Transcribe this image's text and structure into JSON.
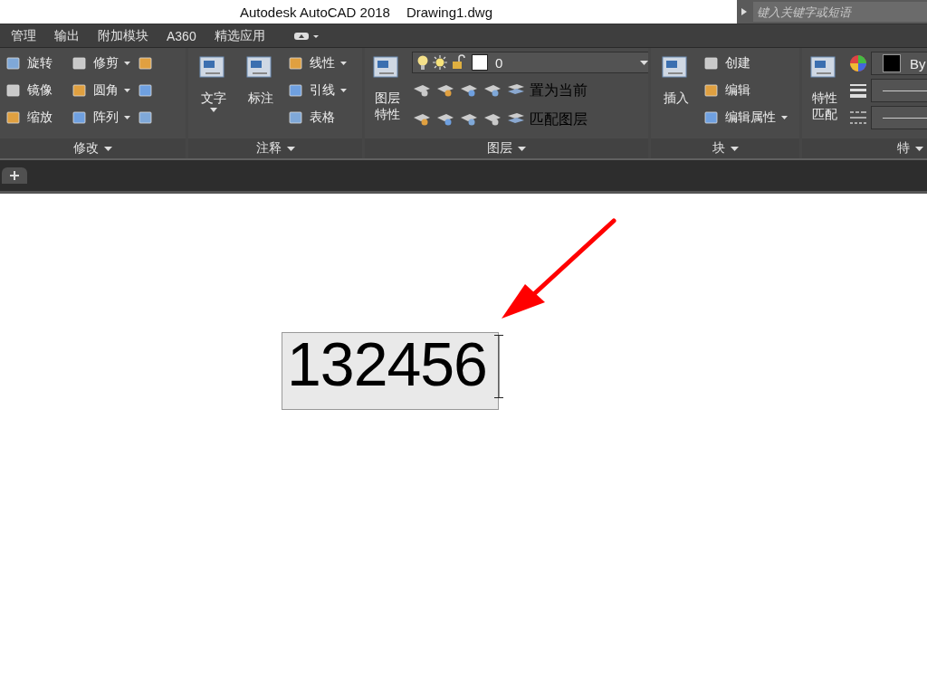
{
  "title_bar": {
    "app": "Autodesk AutoCAD 2018",
    "file": "Drawing1.dwg",
    "search": {
      "placeholder": "键入关键字或短语"
    }
  },
  "menu_tabs": [
    {
      "label": "管理"
    },
    {
      "label": "输出"
    },
    {
      "label": "附加模块"
    },
    {
      "label": "A360"
    },
    {
      "label": "精选应用"
    }
  ],
  "ribbon": [
    {
      "title": "修改",
      "groups": [
        {
          "kind": "column",
          "items": [
            {
              "label": "旋转",
              "dropdown": false
            },
            {
              "label": "镜像",
              "dropdown": false
            },
            {
              "label": "缩放",
              "dropdown": false
            }
          ]
        },
        {
          "kind": "column",
          "items": [
            {
              "label": "修剪",
              "dropdown": true
            },
            {
              "label": "圆角",
              "dropdown": true
            },
            {
              "label": "阵列",
              "dropdown": true
            }
          ]
        },
        {
          "kind": "column",
          "items": [
            {
              "dropdown": false
            },
            {
              "dropdown": false
            },
            {
              "dropdown": false
            }
          ]
        }
      ]
    },
    {
      "title": "注释",
      "groups": [
        {
          "kind": "large",
          "label": "文字",
          "dropdown": true
        },
        {
          "kind": "large",
          "label": "标注",
          "dropdown": false
        },
        {
          "kind": "column",
          "items": [
            {
              "label": "线性",
              "dropdown": true
            },
            {
              "label": "引线",
              "dropdown": true
            },
            {
              "label": "表格",
              "dropdown": false
            }
          ]
        }
      ]
    },
    {
      "title": "图层",
      "groups": [
        {
          "kind": "large",
          "label": "图层特性",
          "dropdown": false
        },
        {
          "kind": "layer",
          "value": "0",
          "rows": [
            {
              "label": "置为当前"
            },
            {
              "label": "匹配图层"
            }
          ]
        }
      ]
    },
    {
      "title": "块",
      "groups": [
        {
          "kind": "large",
          "label": "插入",
          "dropdown": false
        },
        {
          "kind": "column",
          "items": [
            {
              "label": "创建",
              "dropdown": false
            },
            {
              "label": "编辑",
              "dropdown": false
            },
            {
              "label": "编辑属性",
              "dropdown": true
            }
          ]
        }
      ]
    },
    {
      "title": "特",
      "groups": [
        {
          "kind": "large",
          "label": "特性匹配",
          "dropdown": false
        },
        {
          "kind": "props",
          "value": "By"
        }
      ]
    }
  ],
  "canvas": {
    "text_editor": {
      "value": "132456"
    }
  }
}
